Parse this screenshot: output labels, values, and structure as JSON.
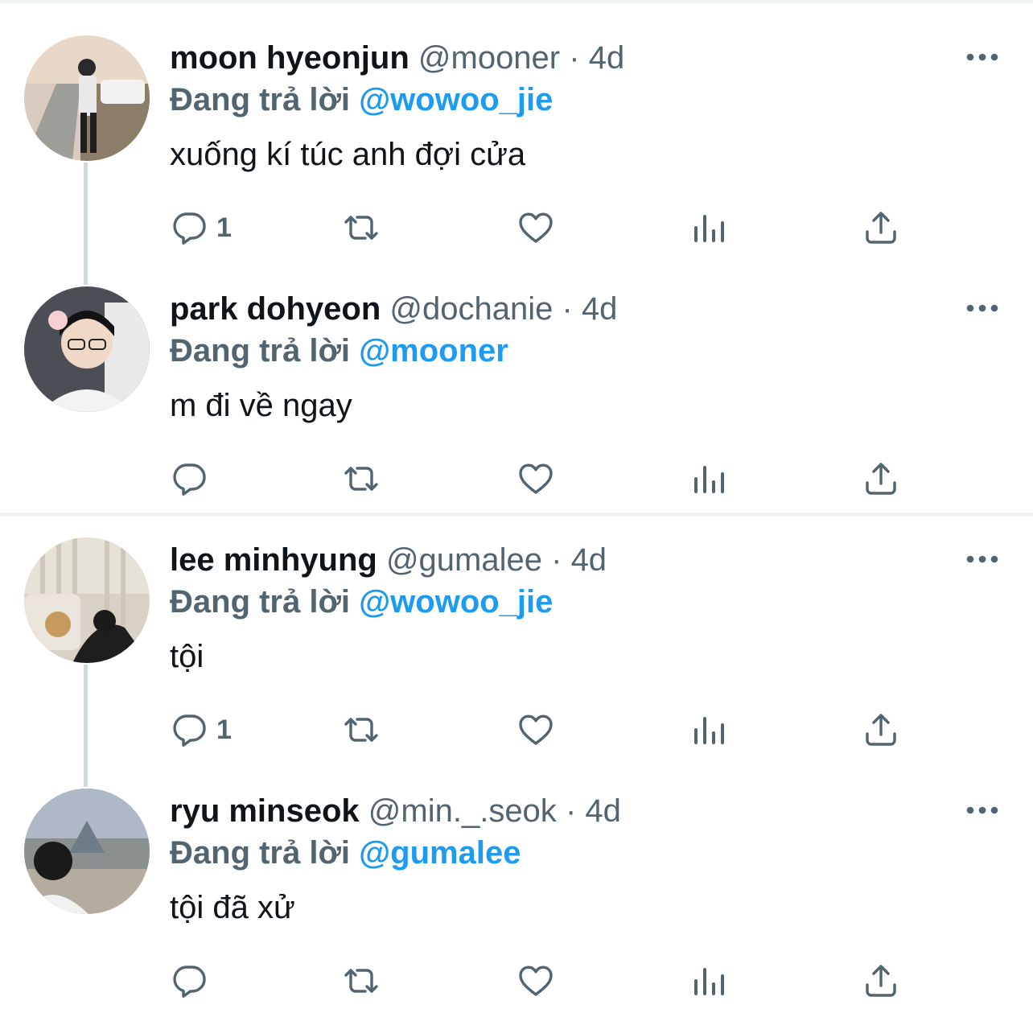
{
  "ui": {
    "reply_prefix": "Đang trả lời",
    "dot": "·"
  },
  "icons": {
    "more": "more-horizontal-icon",
    "reply": "reply-icon",
    "retweet": "retweet-icon",
    "like": "heart-icon",
    "views": "views-chart-icon",
    "share": "share-icon"
  },
  "colors": {
    "name": "#0f1419",
    "muted": "#536471",
    "link": "#1d9bf0",
    "divider": "#eff3f4",
    "thread_line": "#cfd9de"
  },
  "tweets": [
    {
      "name": "moon hyeonjun",
      "handle": "@mooner",
      "time": "4d",
      "reply_to": "@wowoo_jie",
      "text": "xuống kí túc anh đợi cửa",
      "reply_count": "1"
    },
    {
      "name": "park dohyeon",
      "handle": "@dochanie",
      "time": "4d",
      "reply_to": "@mooner",
      "text": "m đi về ngay",
      "reply_count": ""
    },
    {
      "name": "lee minhyung",
      "handle": "@gumalee",
      "time": "4d",
      "reply_to": "@wowoo_jie",
      "text": "tội",
      "reply_count": "1"
    },
    {
      "name": "ryu minseok",
      "handle": "@min._.seok",
      "time": "4d",
      "reply_to": "@gumalee",
      "text": "tội đã xử",
      "reply_count": ""
    }
  ]
}
